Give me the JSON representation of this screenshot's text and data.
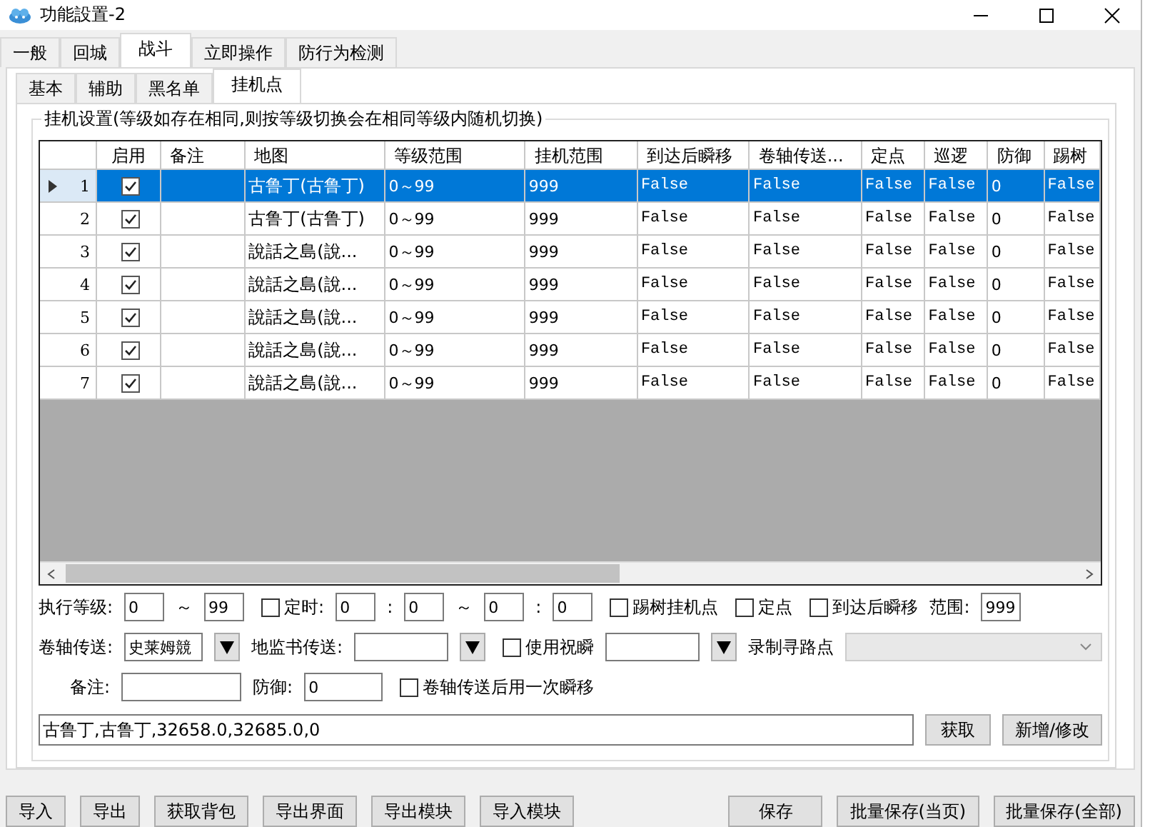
{
  "window": {
    "title": "功能設置-2"
  },
  "tabs": [
    {
      "label": "一般",
      "selected": false
    },
    {
      "label": "回城",
      "selected": false
    },
    {
      "label": "战斗",
      "selected": true
    },
    {
      "label": "立即操作",
      "selected": false
    },
    {
      "label": "防行为检测",
      "selected": false
    }
  ],
  "subtabs": [
    {
      "label": "基本",
      "selected": false
    },
    {
      "label": "辅助",
      "selected": false
    },
    {
      "label": "黑名单",
      "selected": false
    },
    {
      "label": "挂机点",
      "selected": true
    }
  ],
  "group": {
    "title": "挂机设置(等级如存在相同,则按等级切换会在相同等级内随机切换)"
  },
  "table": {
    "columns": [
      {
        "label": "启用",
        "kind": "check"
      },
      {
        "label": "备注",
        "kind": "note"
      },
      {
        "label": "地图",
        "kind": "text"
      },
      {
        "label": "等级范围",
        "kind": "text"
      },
      {
        "label": "挂机范围",
        "kind": "text"
      },
      {
        "label": "到达后瞬移",
        "kind": "mono"
      },
      {
        "label": "卷轴传送...",
        "kind": "mono"
      },
      {
        "label": "定点",
        "kind": "mono"
      },
      {
        "label": "巡逻",
        "kind": "mono"
      },
      {
        "label": "防御",
        "kind": "text"
      },
      {
        "label": "踢树",
        "kind": "mono"
      }
    ],
    "rows": [
      {
        "number": "1",
        "selected": true,
        "enabled": true,
        "cells": [
          "",
          "",
          "古鲁丁(古鲁丁)",
          "0～99",
          "999",
          "False",
          "False",
          "False",
          "False",
          "0",
          "False"
        ]
      },
      {
        "number": "2",
        "selected": false,
        "enabled": true,
        "cells": [
          "",
          "",
          "古鲁丁(古鲁丁)",
          "0～99",
          "999",
          "False",
          "False",
          "False",
          "False",
          "0",
          "False"
        ]
      },
      {
        "number": "3",
        "selected": false,
        "enabled": true,
        "cells": [
          "",
          "",
          "說話之島(說...",
          "0～99",
          "999",
          "False",
          "False",
          "False",
          "False",
          "0",
          "False"
        ]
      },
      {
        "number": "4",
        "selected": false,
        "enabled": true,
        "cells": [
          "",
          "",
          "說話之島(說...",
          "0～99",
          "999",
          "False",
          "False",
          "False",
          "False",
          "0",
          "False"
        ]
      },
      {
        "number": "5",
        "selected": false,
        "enabled": true,
        "cells": [
          "",
          "",
          "說話之島(說...",
          "0～99",
          "999",
          "False",
          "False",
          "False",
          "False",
          "0",
          "False"
        ]
      },
      {
        "number": "6",
        "selected": false,
        "enabled": true,
        "cells": [
          "",
          "",
          "說話之島(說...",
          "0～99",
          "999",
          "False",
          "False",
          "False",
          "False",
          "0",
          "False"
        ]
      },
      {
        "number": "7",
        "selected": false,
        "enabled": true,
        "cells": [
          "",
          "",
          "說話之島(說...",
          "0～99",
          "999",
          "False",
          "False",
          "False",
          "False",
          "0",
          "False"
        ]
      }
    ]
  },
  "form": [
    [
      {
        "kind": "label",
        "text": "执行等级:"
      },
      {
        "kind": "tiny",
        "value": "0"
      },
      {
        "kind": "sep",
        "text": "～"
      },
      {
        "kind": "tiny",
        "value": "99"
      },
      {
        "kind": "check",
        "text": "定时:",
        "checked": false
      },
      {
        "kind": "tiny",
        "value": "0"
      },
      {
        "kind": "sep",
        "text": ":"
      },
      {
        "kind": "tiny",
        "value": "0"
      },
      {
        "kind": "sep",
        "text": "～"
      },
      {
        "kind": "tiny",
        "value": "0"
      },
      {
        "kind": "sep",
        "text": ":"
      },
      {
        "kind": "tiny",
        "value": "0"
      },
      {
        "kind": "check",
        "text": "踢树挂机点",
        "checked": false
      },
      {
        "kind": "check",
        "text": "定点",
        "checked": false
      },
      {
        "kind": "check",
        "text": "到达后瞬移",
        "checked": false
      },
      {
        "kind": "label",
        "text": "范围:"
      },
      {
        "kind": "tiny",
        "value": "999"
      }
    ],
    [
      {
        "kind": "label",
        "text": "卷轴传送:"
      },
      {
        "kind": "small",
        "value": "史莱姆競"
      },
      {
        "kind": "drop"
      },
      {
        "kind": "label",
        "text": "地监书传送:"
      },
      {
        "kind": "medium"
      },
      {
        "kind": "drop"
      },
      {
        "kind": "check",
        "text": "使用祝瞬",
        "checked": false
      },
      {
        "kind": "medium"
      },
      {
        "kind": "drop"
      },
      {
        "kind": "label",
        "text": "录制寻路点"
      },
      {
        "kind": "combo"
      }
    ],
    [
      {
        "kind": "label",
        "text": "备注:"
      },
      {
        "kind": "large"
      },
      {
        "kind": "label",
        "text": "防御:"
      },
      {
        "kind": "small",
        "value": "0"
      },
      {
        "kind": "check",
        "text": "卷轴传送后用一次瞬移",
        "checked": false
      }
    ]
  ],
  "coords": {
    "value": "古鲁丁,古鲁丁,32658.0,32685.0,0"
  },
  "coord_buttons": [
    "获取",
    "新增/修改"
  ],
  "bottom_left": [
    "导入",
    "导出",
    "获取背包",
    "导出界面",
    "导出模块",
    "导入模块"
  ],
  "bottom_right": [
    "保存",
    "批量保存(当页)",
    "批量保存(全部)"
  ]
}
